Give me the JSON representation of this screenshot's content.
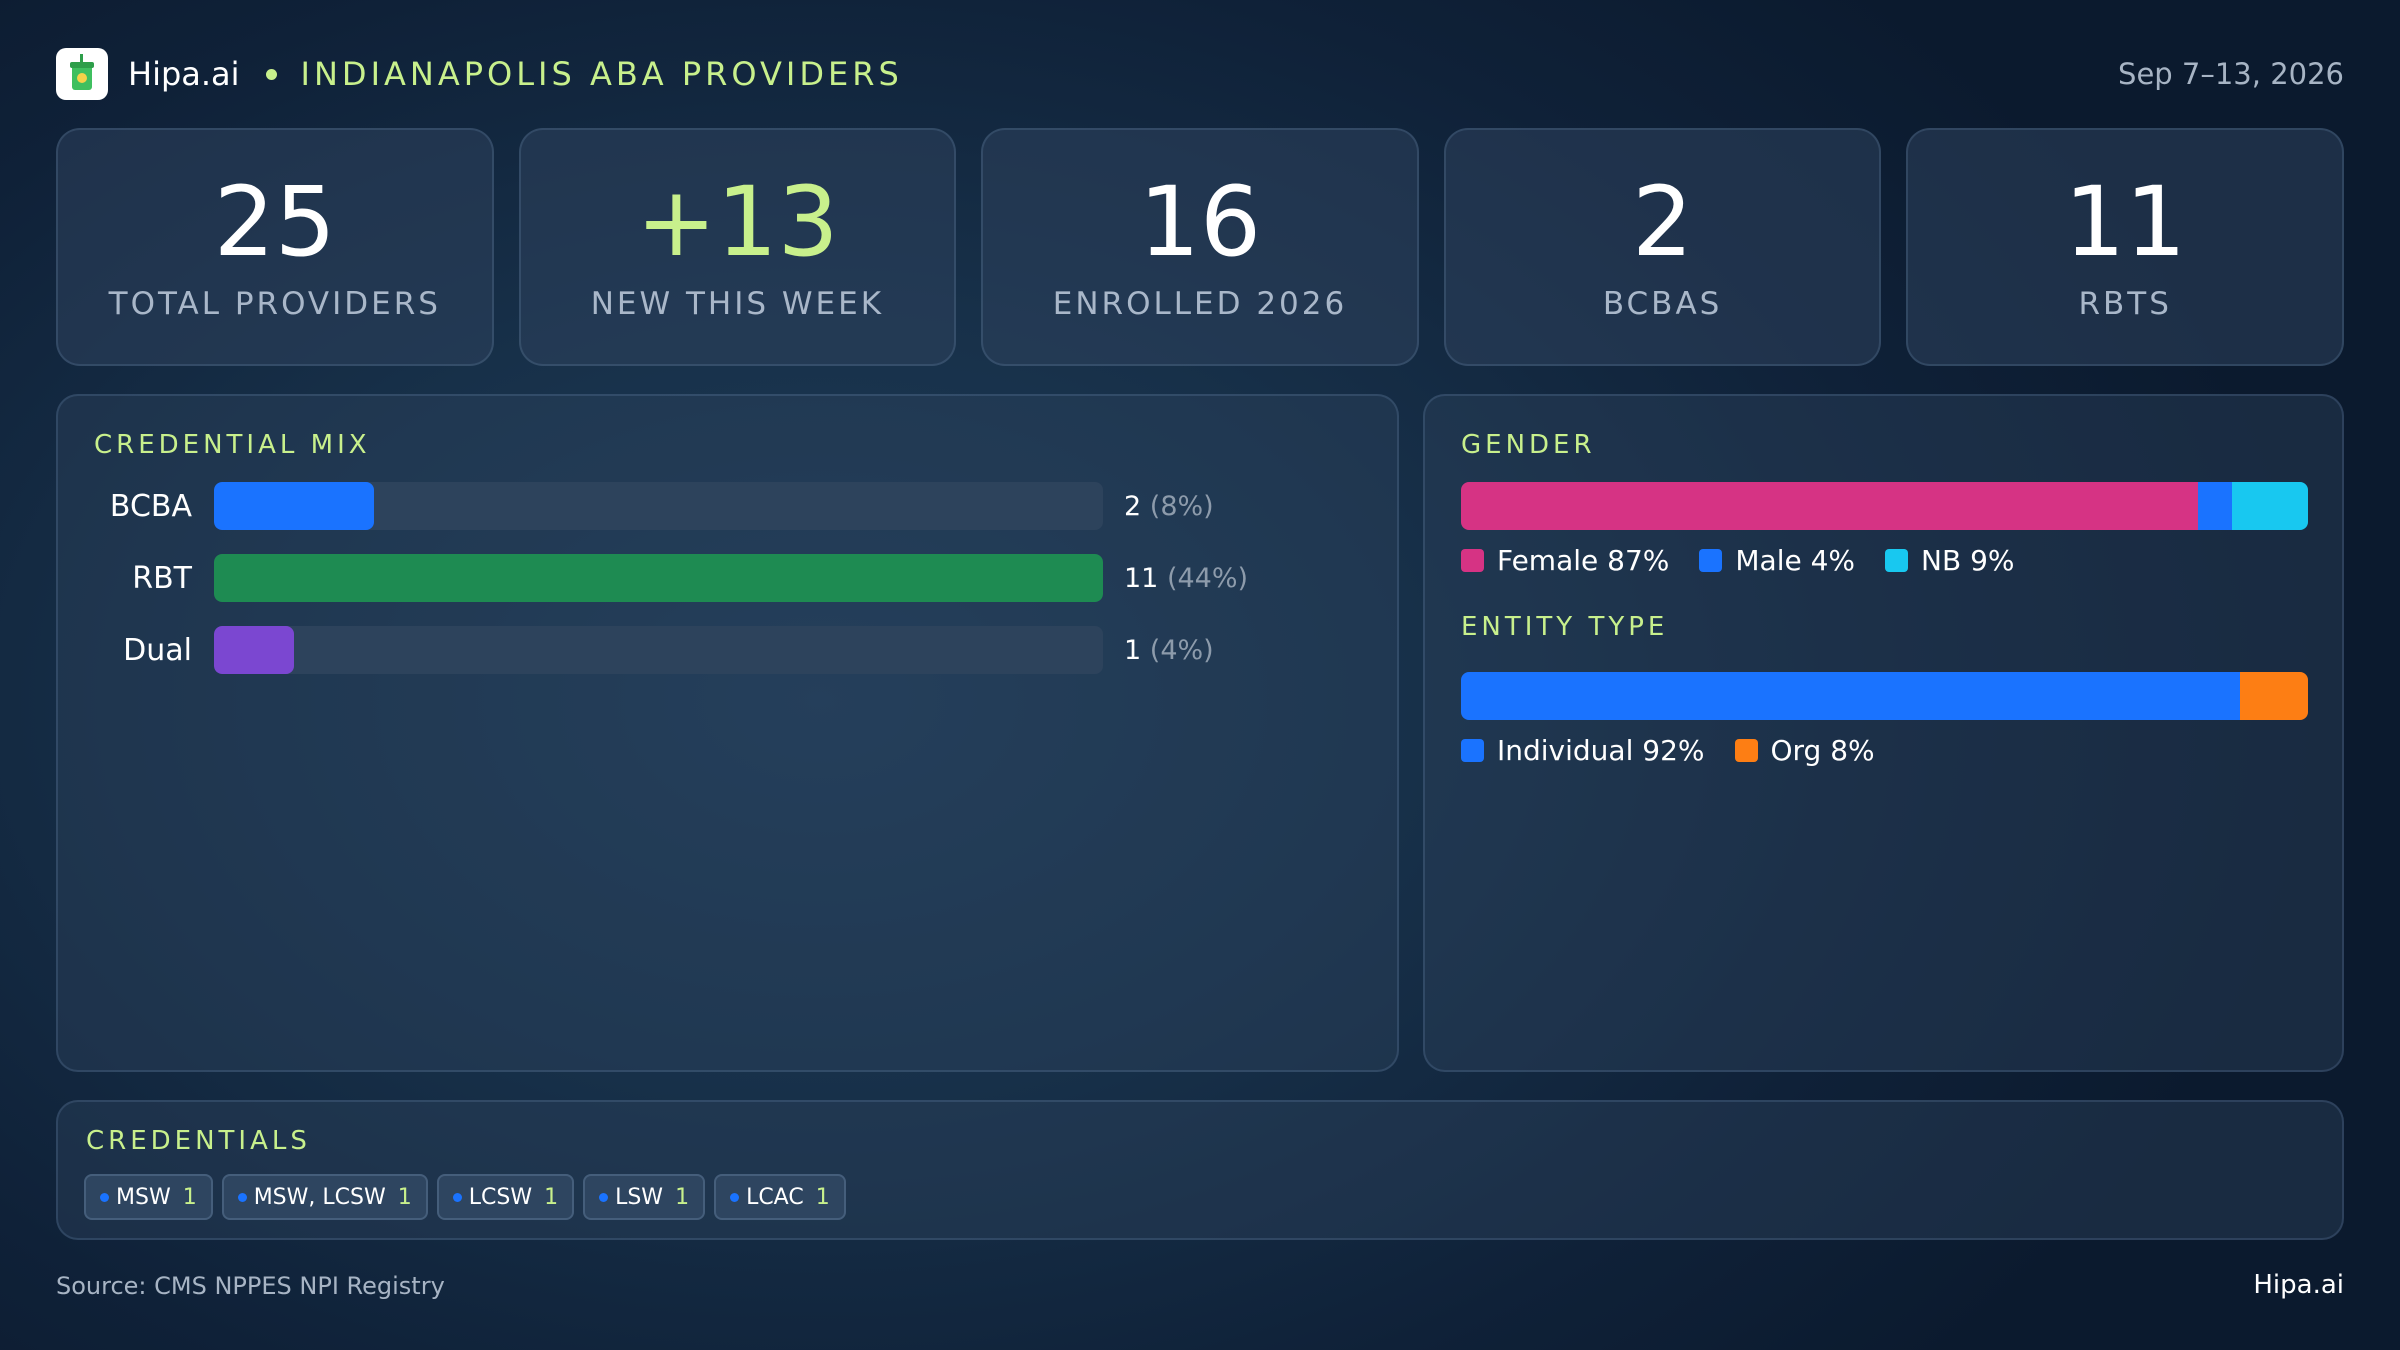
{
  "header": {
    "brand": "Hipa.ai",
    "title": "INDIANAPOLIS  ABA  PROVIDERS",
    "date": "Sep 7–13, 2026"
  },
  "stats": [
    {
      "value": "25",
      "label": "TOTAL  PROVIDERS"
    },
    {
      "value": "+13",
      "label": "NEW THIS WEEK"
    },
    {
      "value": "16",
      "label": "ENROLLED 2026"
    },
    {
      "value": "2",
      "label": "BCBAS"
    },
    {
      "value": "11",
      "label": "RBTS"
    }
  ],
  "credential_mix": {
    "title": "CREDENTIAL  MIX",
    "rows": [
      {
        "label": "BCBA",
        "count": "2",
        "pct": "(8%)",
        "fraction": 0.18,
        "color": "#1a73ff"
      },
      {
        "label": "RBT",
        "count": "11",
        "pct": "(44%)",
        "fraction": 1.0,
        "color": "#1e8b52"
      },
      {
        "label": "Dual",
        "count": "1",
        "pct": "(4%)",
        "fraction": 0.09,
        "color": "#7b47d1"
      }
    ]
  },
  "gender": {
    "title": "GENDER",
    "segments": [
      {
        "label": "Female 87%",
        "percent": 87,
        "color": "#d63384"
      },
      {
        "label": "Male 4%",
        "percent": 4,
        "color": "#1a73ff"
      },
      {
        "label": "NB 9%",
        "percent": 9,
        "color": "#18c8f0"
      }
    ]
  },
  "entity_type": {
    "title": "ENTITY  TYPE",
    "segments": [
      {
        "label": "Individual 92%",
        "percent": 92,
        "color": "#1a73ff"
      },
      {
        "label": "Org 8%",
        "percent": 8,
        "color": "#fd7e14"
      }
    ]
  },
  "credentials": {
    "title": "CREDENTIALS",
    "chips": [
      {
        "label": "MSW",
        "count": "1"
      },
      {
        "label": "MSW, LCSW",
        "count": "1"
      },
      {
        "label": "LCSW",
        "count": "1"
      },
      {
        "label": "LSW",
        "count": "1"
      },
      {
        "label": "LCAC",
        "count": "1"
      }
    ]
  },
  "footer": {
    "source": "Source: CMS NPPES NPI Registry",
    "brand": "Hipa.ai"
  }
}
